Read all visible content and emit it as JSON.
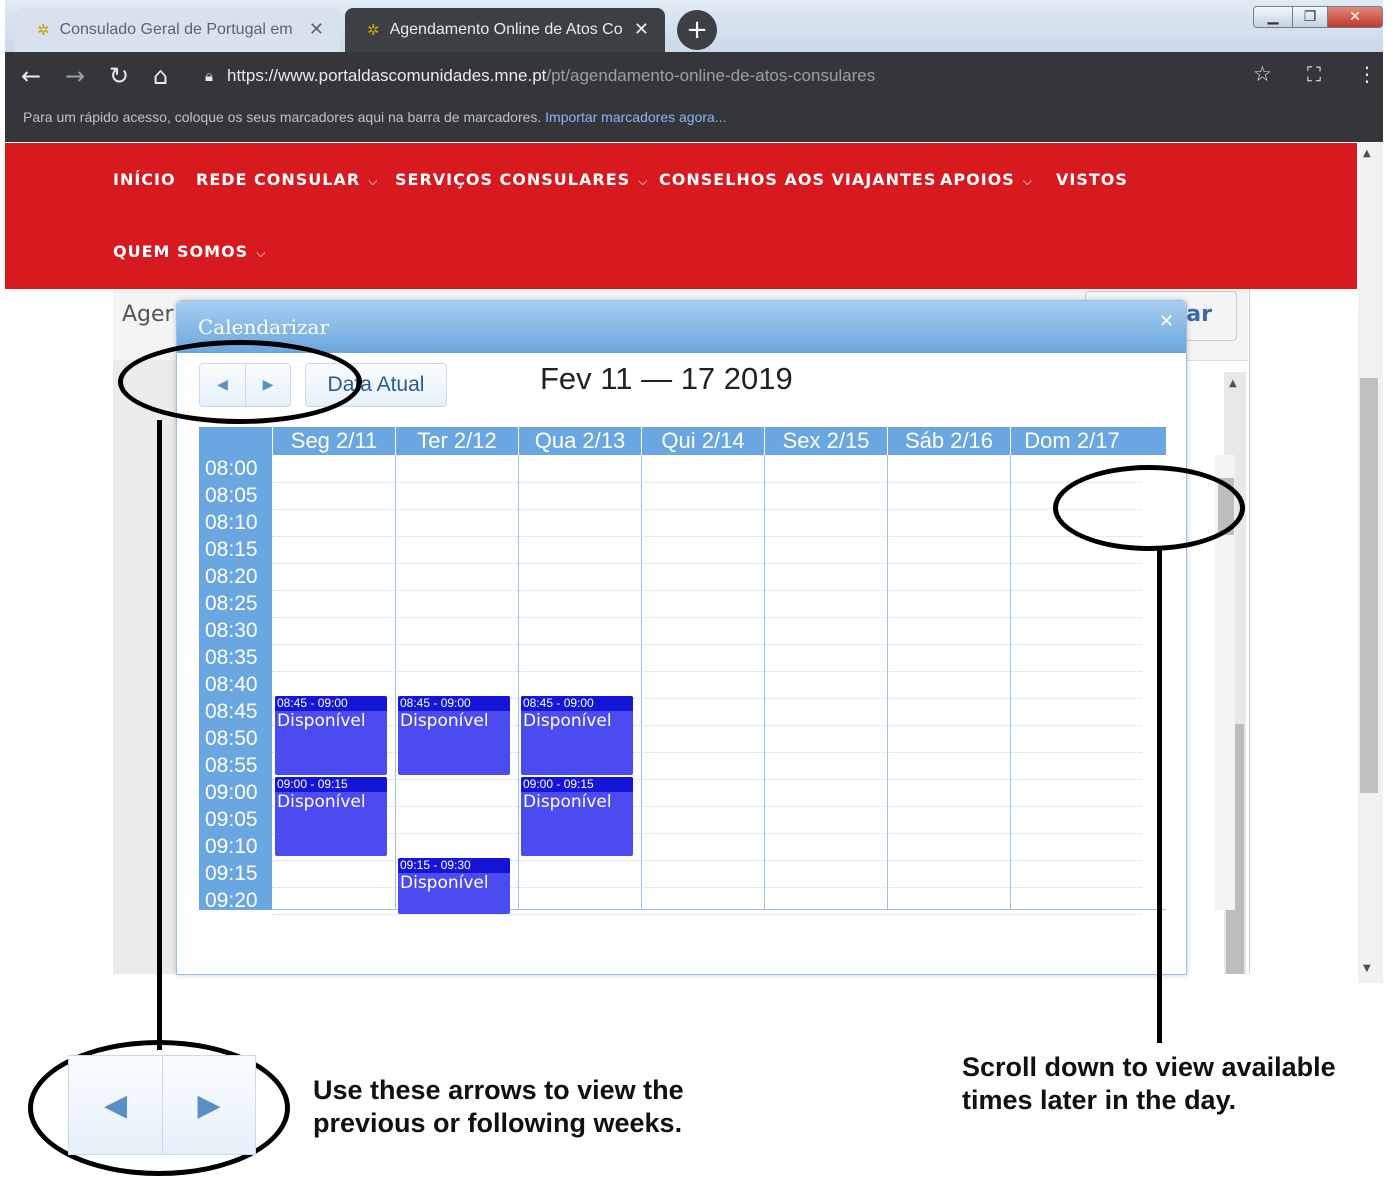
{
  "browser": {
    "tabs": [
      {
        "label": "Consulado Geral de Portugal em",
        "active": false
      },
      {
        "label": "Agendamento Online de Atos Co",
        "active": true
      }
    ],
    "url_host": "https://www.portaldascomunidades.mne.pt",
    "url_path": "/pt/agendamento-online-de-atos-consulares",
    "bookmark_hint": "Para um rápido acesso, coloque os seus marcadores aqui na barra de marcadores.",
    "bookmark_link": "Importar marcadores agora..."
  },
  "nav": {
    "items": [
      "INÍCIO",
      "REDE CONSULAR",
      "SERVIÇOS CONSULARES",
      "CONSELHOS AOS VIAJANTES",
      "APOIOS",
      "VISTOS",
      "QUEM SOMOS"
    ]
  },
  "page": {
    "heading_fragment": "Ager",
    "button_fragment": "ar"
  },
  "modal": {
    "title": "Calendarizar",
    "today_button": "Data Atual",
    "week_title": "Fev 11 — 17 2019",
    "days": [
      "Seg 2/11",
      "Ter 2/12",
      "Qua 2/13",
      "Qui 2/14",
      "Sex 2/15",
      "Sáb 2/16",
      "Dom 2/17"
    ],
    "times": [
      "08:00",
      "08:05",
      "08:10",
      "08:15",
      "08:20",
      "08:25",
      "08:30",
      "08:35",
      "08:40",
      "08:45",
      "08:50",
      "08:55",
      "09:00",
      "09:05",
      "09:10",
      "09:15",
      "09:20"
    ],
    "events": [
      {
        "day": 0,
        "time": "08:45 - 09:00",
        "label": "Disponível"
      },
      {
        "day": 0,
        "time": "09:00 - 09:15",
        "label": "Disponível"
      },
      {
        "day": 1,
        "time": "08:45 - 09:00",
        "label": "Disponível"
      },
      {
        "day": 1,
        "time": "09:15 - 09:30",
        "label": "Disponível"
      },
      {
        "day": 2,
        "time": "08:45 - 09:00",
        "label": "Disponível"
      },
      {
        "day": 2,
        "time": "09:00 - 09:15",
        "label": "Disponível"
      }
    ]
  },
  "annotations": {
    "arrows_note": [
      "Use these arrows to view the",
      "previous or following weeks."
    ],
    "scroll_note": [
      "Scroll down to view available",
      "times later in the day."
    ]
  },
  "colors": {
    "nav_red": "#d71920",
    "calendar_blue": "#6aa6df",
    "event_blue": "#4b4bf0"
  }
}
